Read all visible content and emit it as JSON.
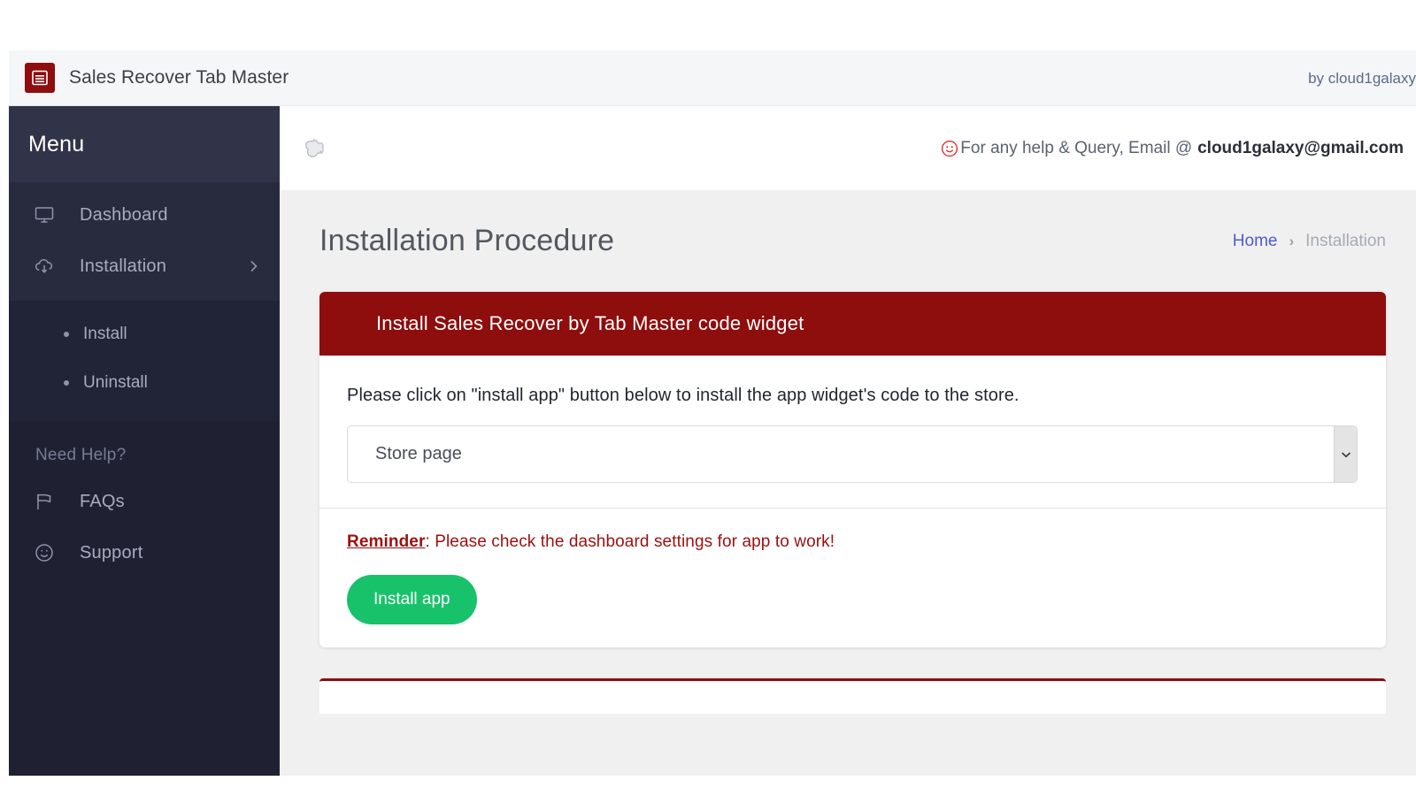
{
  "brand": {
    "title": "Sales Recover Tab Master",
    "logo_icon": "app-window-icon",
    "by_text": "by cloud1galaxy"
  },
  "sidebar": {
    "menu_label": "Menu",
    "items": [
      {
        "label": "Dashboard",
        "icon": "monitor-icon",
        "has_caret": false
      },
      {
        "label": "Installation",
        "icon": "cloud-download-icon",
        "has_caret": true
      }
    ],
    "submenu": [
      {
        "label": "Install"
      },
      {
        "label": "Uninstall"
      }
    ],
    "help_section_title": "Need Help?",
    "help_items": [
      {
        "label": "FAQs",
        "icon": "flag-icon"
      },
      {
        "label": "Support",
        "icon": "smiley-icon"
      }
    ]
  },
  "topbar": {
    "toggle_icon": "menu-toggle-icon",
    "help_emoji": "smiley-face-emoji",
    "help_prefix": "For any help & Query, Email @",
    "help_email": "cloud1galaxy@gmail.com"
  },
  "page": {
    "title": "Installation Procedure",
    "breadcrumb": {
      "home": "Home",
      "separator": "›",
      "current": "Installation"
    }
  },
  "card": {
    "header": "Install Sales Recover by Tab Master code widget",
    "instruction": "Please click on \"install app\" button below to install the app widget's code to the store.",
    "select": {
      "value": "Store page",
      "options": [
        "Store page"
      ]
    },
    "reminder_bold": "Reminder",
    "reminder_rest": ": Please check the dashboard settings for app to work!",
    "install_button": "Install app"
  },
  "colors": {
    "brand_red": "#8e0d0d",
    "sidebar_dark": "#1f2133",
    "accent_green": "#18c26b",
    "link_blue": "#4f5bd5"
  }
}
